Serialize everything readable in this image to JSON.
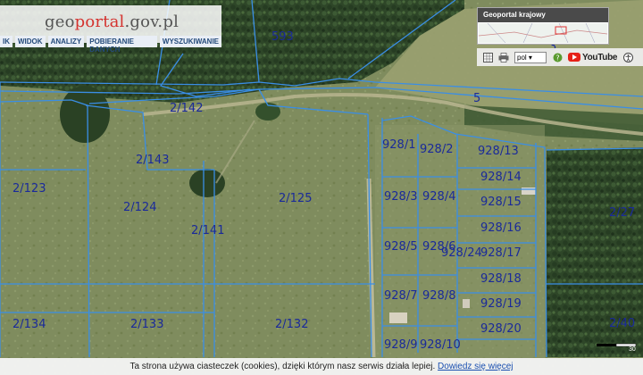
{
  "header": {
    "logo_prefix": "geo",
    "logo_accent": "portal",
    "logo_suffix": ".gov.pl",
    "menu": [
      "IK",
      "WIDOK",
      "ANALIZY",
      "POBIERANIE DANYCH",
      "WYSZUKIWANIE"
    ]
  },
  "national_map": {
    "title": "Geoportal krajowy"
  },
  "toolbar": {
    "language": "pol",
    "youtube_label": "YouTube"
  },
  "cookie_bar": {
    "text": "Ta strona używa ciasteczek (cookies), dzięki którym nasz serwis działa lepiej.",
    "link": "Dowiedz się więcej"
  },
  "map": {
    "parcel_labels": [
      "593",
      "5",
      "2/142",
      "2/143",
      "2/123",
      "2/124",
      "2/141",
      "2/125",
      "928/1",
      "928/2",
      "928/13",
      "928/14",
      "928/3",
      "928/4",
      "928/15",
      "928/16",
      "928/5",
      "928/6",
      "928/24",
      "928/17",
      "928/18",
      "928/7",
      "928/8",
      "928/19",
      "928/20",
      "928/9",
      "928/10",
      "2/134",
      "2/133",
      "2/132",
      "2/27",
      "2/40",
      "3"
    ],
    "scale_text": "30"
  },
  "colors": {
    "parcel_line": "#3a8ee6",
    "parcel_label": "#1a2a9a",
    "logo_accent": "#d4322e",
    "forest": "#2f4a2a",
    "meadow": "#7d8a5c"
  }
}
